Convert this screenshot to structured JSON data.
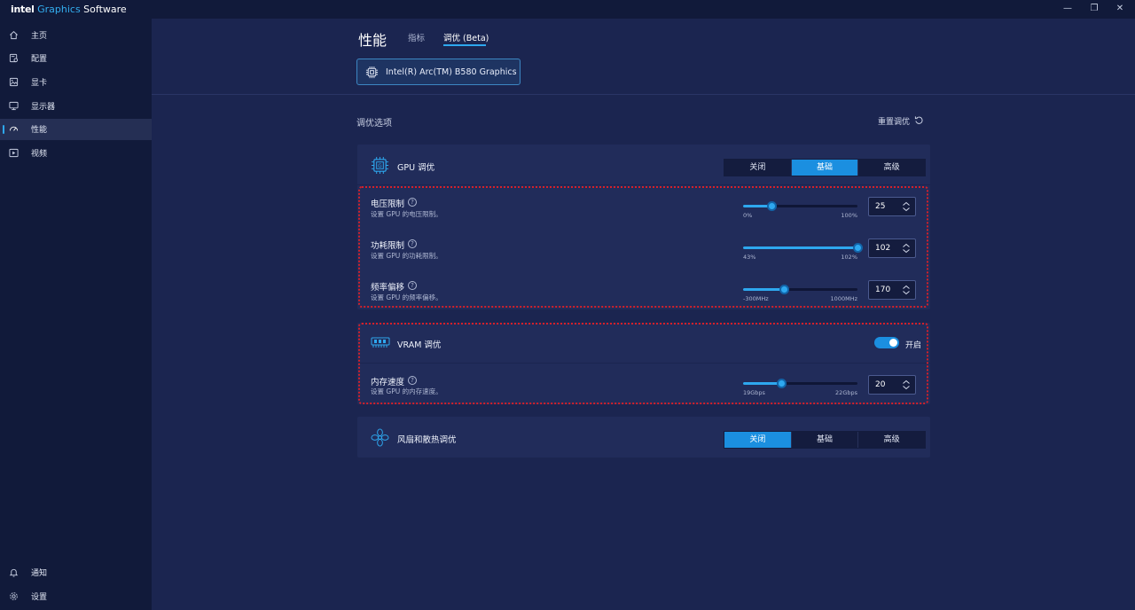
{
  "app": {
    "logo_intel": "intel",
    "logo_graphics": "Graphics",
    "logo_software": "Software"
  },
  "window_controls": {
    "minimize_glyph": "—",
    "restore_glyph": "❐",
    "close_glyph": "✕"
  },
  "sidebar": {
    "items": [
      {
        "label": "主页",
        "icon": "home-icon"
      },
      {
        "label": "配置",
        "icon": "profile-icon"
      },
      {
        "label": "显卡",
        "icon": "graphics-card-icon"
      },
      {
        "label": "显示器",
        "icon": "monitor-icon"
      },
      {
        "label": "性能",
        "icon": "performance-gauge-icon",
        "active": true
      },
      {
        "label": "视频",
        "icon": "video-icon"
      }
    ],
    "bottom": [
      {
        "label": "通知",
        "icon": "bell-icon"
      },
      {
        "label": "设置",
        "icon": "gear-icon"
      }
    ]
  },
  "header": {
    "title": "性能",
    "tabs": [
      {
        "label": "指标"
      },
      {
        "label": "调优 (Beta)",
        "active": true
      }
    ],
    "gpu_name": "Intel(R) Arc(TM) B580 Graphics"
  },
  "tuning": {
    "section_title": "调优选项",
    "reset_label": "重置调优",
    "gpu_card": {
      "title": "GPU 调优",
      "modes": [
        "关闭",
        "基础",
        "高级"
      ],
      "selected_mode": "基础",
      "rows": [
        {
          "label": "电压限制",
          "desc": "设置 GPU 的电压限制。",
          "min_label": "0%",
          "max_label": "100%",
          "min": 0,
          "max": 100,
          "value": 25,
          "value_text": "25"
        },
        {
          "label": "功耗限制",
          "desc": "设置 GPU 的功耗限制。",
          "min_label": "43%",
          "max_label": "102%",
          "min": 43,
          "max": 102,
          "value": 102,
          "value_text": "102"
        },
        {
          "label": "频率偏移",
          "desc": "设置 GPU 的频率偏移。",
          "min_label": "-300MHz",
          "max_label": "1000MHz",
          "min": -300,
          "max": 1000,
          "value": 170,
          "value_text": "170"
        }
      ]
    },
    "vram_card": {
      "title": "VRAM 调优",
      "toggle_label": "开启",
      "toggle_on": true,
      "rows": [
        {
          "label": "内存速度",
          "desc": "设置 GPU 的内存速度。",
          "min_label": "19Gbps",
          "max_label": "22Gbps",
          "min": 19,
          "max": 22,
          "value": 20,
          "value_text": "20"
        }
      ]
    },
    "fan_card": {
      "title": "风扇和散热调优",
      "modes": [
        "关闭",
        "基础",
        "高级"
      ],
      "selected_mode": "关闭"
    }
  },
  "colors": {
    "accent": "#2ea8ef",
    "highlight_border": "#d4202a",
    "background": "#1b2550",
    "card": "#212c5a"
  }
}
